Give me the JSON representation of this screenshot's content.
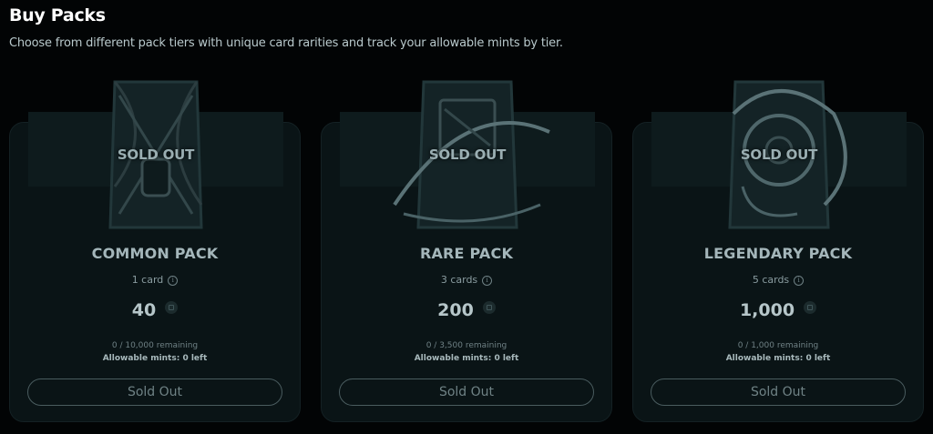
{
  "header": {
    "title": "Buy Packs",
    "subtitle": "Choose from different pack tiers with unique card rarities and track your allowable mints by tier."
  },
  "packs": [
    {
      "overlay": "SOLD OUT",
      "name": "COMMON PACK",
      "card_count": "1 card",
      "price": "40",
      "remaining": "0 / 10,000 remaining",
      "mints": "Allowable mints: 0 left",
      "button": "Sold Out",
      "art_icon": "chained-pack-icon"
    },
    {
      "overlay": "SOLD OUT",
      "name": "RARE PACK",
      "card_count": "3 cards",
      "price": "200",
      "remaining": "0 / 3,500 remaining",
      "mints": "Allowable mints: 0 left",
      "button": "Sold Out",
      "art_icon": "rare-pack-icon"
    },
    {
      "overlay": "SOLD OUT",
      "name": "LEGENDARY PACK",
      "card_count": "5 cards",
      "price": "1,000",
      "remaining": "0 / 1,000 remaining",
      "mints": "Allowable mints: 0 left",
      "button": "Sold Out",
      "art_icon": "legendary-pack-icon"
    }
  ],
  "colors": {
    "background": "#020405",
    "card": "#0a1416",
    "accent_text": "#a4b6ba"
  }
}
